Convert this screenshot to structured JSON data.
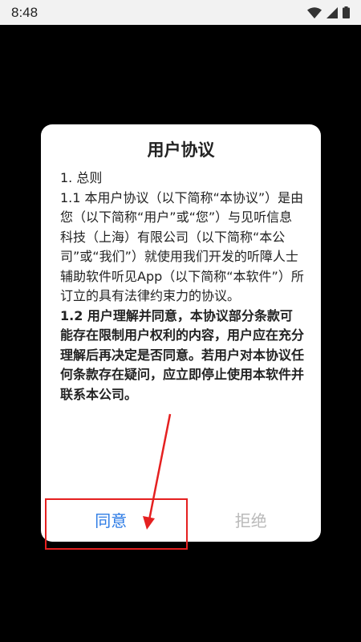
{
  "status_bar": {
    "time": "8:48",
    "icons": [
      "wifi-icon",
      "cellular-signal-icon",
      "battery-icon"
    ]
  },
  "dialog": {
    "title": "用户协议",
    "paragraphs": [
      {
        "text": "1. 总则",
        "bold": false
      },
      {
        "text": "1.1 本用户协议（以下简称“本协议”）是由您（以下简称“用户”或“您”）与见听信息科技（上海）有限公司（以下简称“本公司”或“我们”）就使用我们开发的听障人士辅助软件听见App（以下简称“本软件”）所订立的具有法律约束力的协议。",
        "bold": false
      },
      {
        "text": "1.2 用户理解并同意，本协议部分条款可能存在限制用户权利的内容，用户应在充分理解后再决定是否同意。若用户对本协议任何条款存在疑问，应立即停止使用本软件并联系本公司。",
        "bold": true
      }
    ],
    "buttons": {
      "agree": "同意",
      "refuse": "拒绝"
    }
  },
  "colors": {
    "agree_text": "#2c7be5",
    "refuse_text": "#b9b9b9",
    "annotation": "#e52020",
    "background": "#000000",
    "status_bar": "#f2f2f2"
  }
}
